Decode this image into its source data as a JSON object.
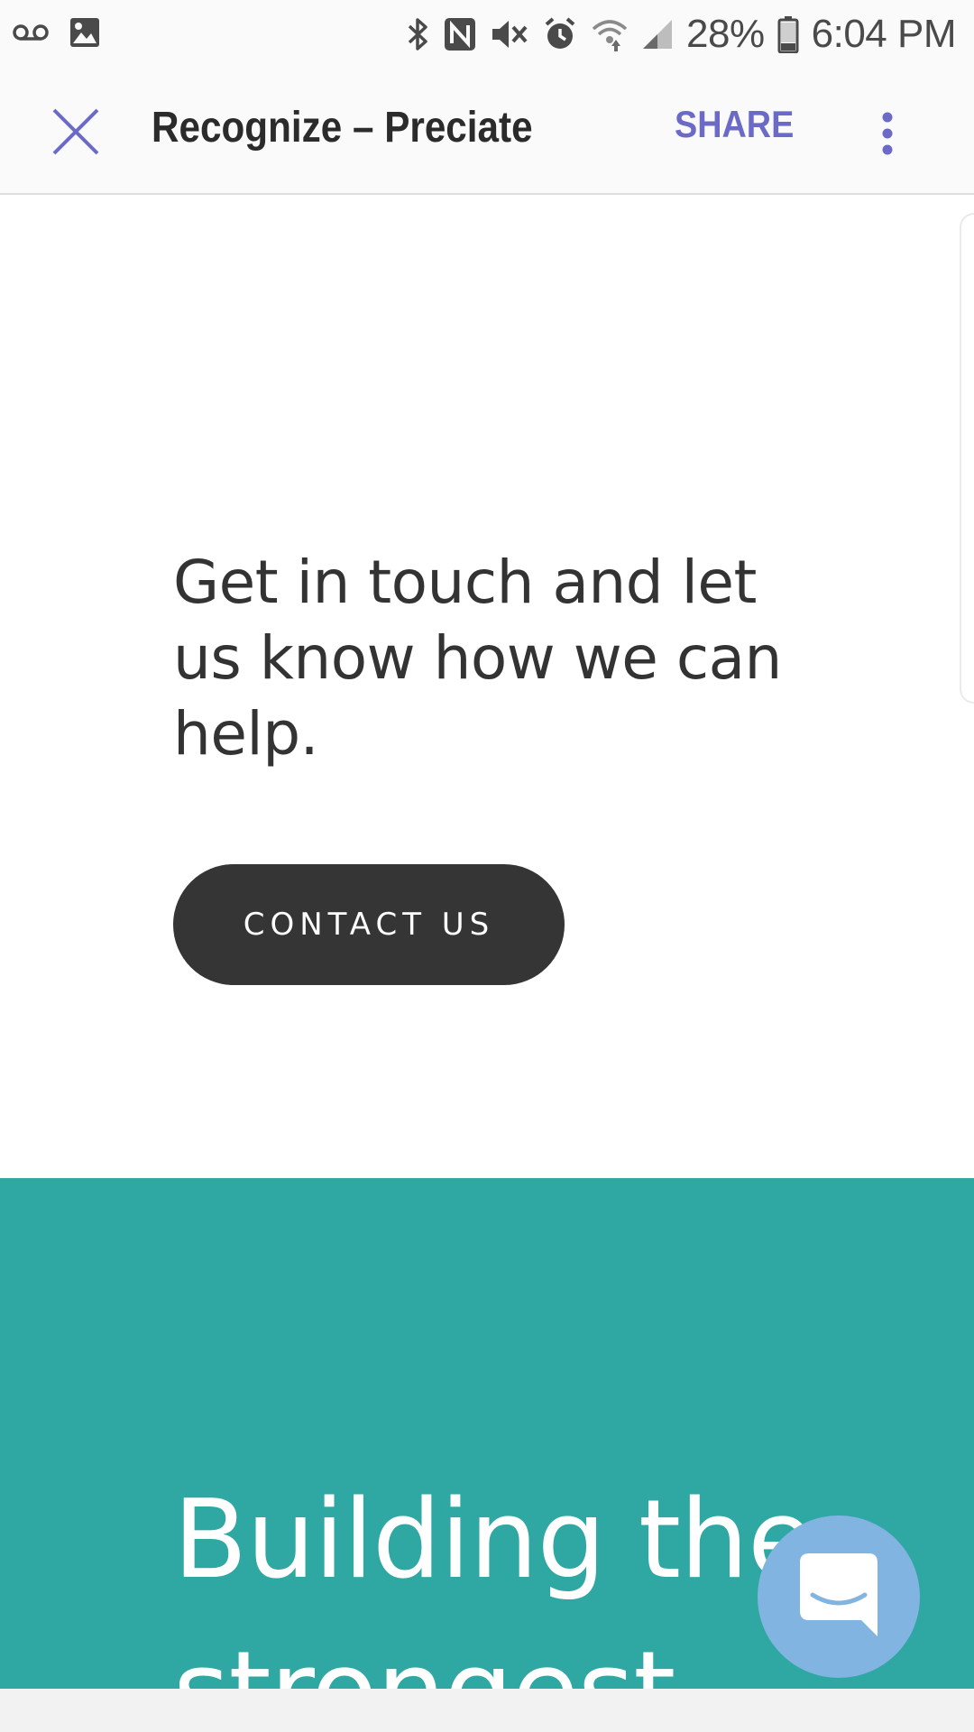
{
  "status_bar": {
    "battery_percent": "28%",
    "time": "6:04 PM",
    "left_icons": [
      "voicemail-icon",
      "gallery-icon"
    ],
    "right_icons": [
      "bluetooth-icon",
      "nfc-icon",
      "mute-icon",
      "alarm-icon",
      "wifi-icon",
      "signal-icon",
      "battery-icon"
    ]
  },
  "app_bar": {
    "title": "Recognize – Preciate",
    "share_label": "SHARE",
    "accent_color": "#6b6bc7"
  },
  "main": {
    "headline": "Get in touch and let us know how we can help.",
    "contact_button_label": "CONTACT US",
    "teal_heading": "Building the strongest",
    "teal_color": "#2fa8a4",
    "button_color": "#353535"
  },
  "chat": {
    "icon": "chat-bubble-icon",
    "color": "#82b4e2"
  }
}
